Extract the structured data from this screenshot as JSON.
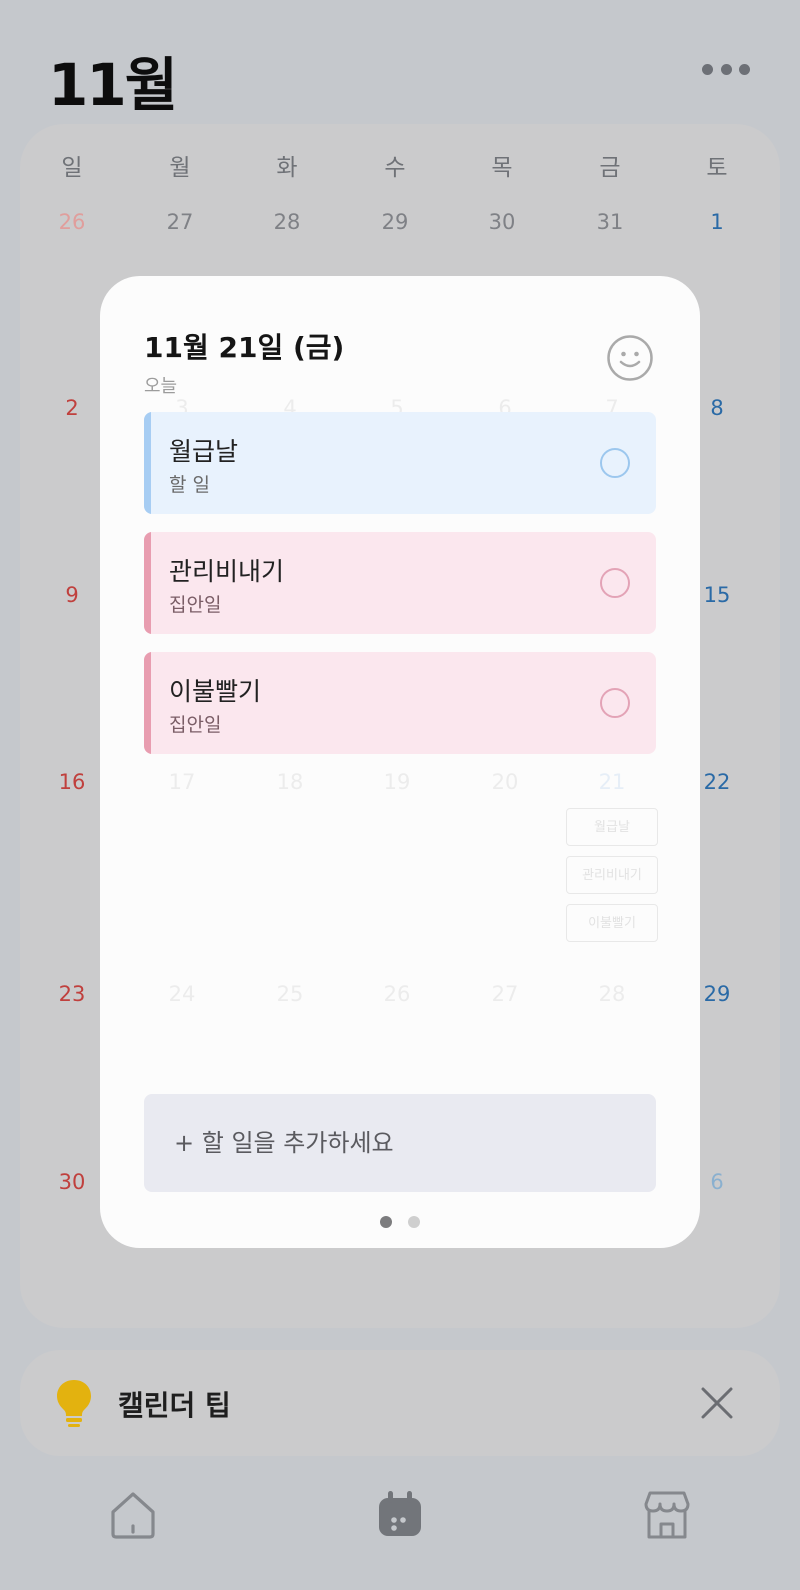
{
  "header": {
    "month_title": "11월"
  },
  "calendar": {
    "weekdays": [
      "일",
      "월",
      "화",
      "수",
      "목",
      "금",
      "토"
    ],
    "row1": [
      "26",
      "27",
      "28",
      "29",
      "30",
      "31",
      "1"
    ],
    "sundays": [
      "2",
      "9",
      "16",
      "23",
      "30"
    ],
    "saturdays": [
      "8",
      "15",
      "22",
      "29",
      "6"
    ],
    "ghost_week2": [
      "3",
      "4",
      "5",
      "6",
      "7"
    ],
    "ghost_week3": [
      "17",
      "18",
      "19",
      "20",
      "21"
    ],
    "ghost_week4": [
      "24",
      "25",
      "26",
      "27",
      "28"
    ],
    "ghost_events": [
      "월급날",
      "관리비내기",
      "이불빨기"
    ]
  },
  "popup": {
    "date_title": "11월 21일 (금)",
    "subtitle": "오늘",
    "tasks": [
      {
        "title": "월급날",
        "category": "할 일"
      },
      {
        "title": "관리비내기",
        "category": "집안일"
      },
      {
        "title": "이불빨기",
        "category": "집안일"
      }
    ],
    "add_task_label": "+ 할 일을 추가하세요"
  },
  "tip": {
    "label": "캘린더 팁"
  },
  "colors": {
    "sunday": "#c0403d",
    "saturday": "#2a6aa6",
    "task_blue": "#a7cdf3",
    "task_pink": "#e89db0",
    "tip_bulb": "#e3b20f"
  },
  "tabs": [
    "home-icon",
    "calendar-icon",
    "store-icon"
  ]
}
